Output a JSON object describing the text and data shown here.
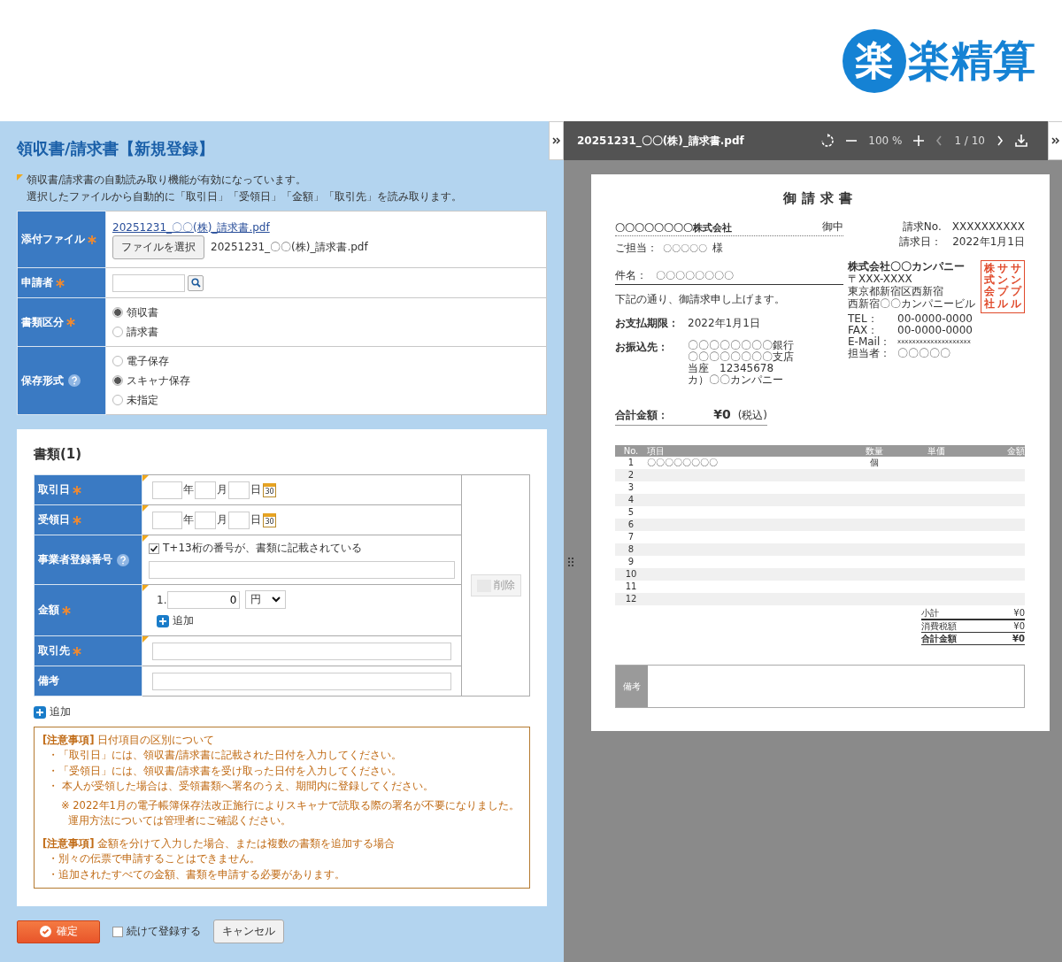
{
  "logo": {
    "mark": "楽",
    "text": "楽精算"
  },
  "form": {
    "title": "領収書/請求書【新規登録】",
    "notice": [
      "領収書/請求書の自動読み取り機能が有効になっています。",
      "選択したファイルから自動的に「取引日」「受領日」「金額」「取引先」を読み取ります。"
    ],
    "fields": [
      {
        "kind": "file",
        "label": "添付ファイル",
        "required": true,
        "help": false,
        "link": "20251231_〇〇(株)_請求書.pdf",
        "button": "ファイルを選択",
        "filename": "20251231_〇〇(株)_請求書.pdf"
      },
      {
        "kind": "search",
        "label": "申請者",
        "required": true,
        "help": false
      },
      {
        "kind": "radio",
        "label": "書類区分",
        "required": true,
        "help": false,
        "options": [
          {
            "label": "領収書",
            "selected": true
          },
          {
            "label": "請求書",
            "selected": false
          }
        ]
      },
      {
        "kind": "radio",
        "label": "保存形式",
        "required": false,
        "help": true,
        "options": [
          {
            "label": "電子保存",
            "selected": false
          },
          {
            "label": "スキャナ保存",
            "selected": true
          },
          {
            "label": "未指定",
            "selected": false
          }
        ]
      }
    ]
  },
  "documents": {
    "title": "書類(1)",
    "rows": [
      {
        "kind": "date",
        "label": "取引日",
        "required": true,
        "help": false,
        "auto_read": true,
        "units": [
          "年",
          "月",
          "日"
        ],
        "calendar": "30"
      },
      {
        "kind": "date",
        "label": "受領日",
        "required": true,
        "help": false,
        "auto_read": true,
        "units": [
          "年",
          "月",
          "日"
        ],
        "calendar": "30"
      },
      {
        "kind": "invoice",
        "label": "事業者登録番号",
        "required": false,
        "help": true,
        "auto_read": true,
        "checkbox": {
          "label": "T+13桁の番号が、書類に記載されている",
          "checked": true
        }
      },
      {
        "kind": "amount",
        "label": "金額",
        "required": true,
        "help": false,
        "auto_read": true,
        "index": "1.",
        "value": "0",
        "currency": "円",
        "add": "追加"
      },
      {
        "kind": "text",
        "label": "取引先",
        "required": true,
        "help": false,
        "auto_read": true
      },
      {
        "kind": "text",
        "label": "備考",
        "required": false,
        "help": false,
        "auto_read": false
      }
    ],
    "delete": {
      "label": "削除",
      "disabled": true
    },
    "add": "追加"
  },
  "notes": [
    {
      "heading": "**[注意事項]** 日付項目の区別について",
      "lines": [
        {
          "kind": "item",
          "text": "・「取引日」には、領収書/請求書に記載された日付を入力してください。"
        },
        {
          "kind": "item",
          "text": "・「受領日」には、領収書/請求書を受け取った日付を入力してください。"
        },
        {
          "kind": "item",
          "text": "・ 本人が受領した場合は、受領書類へ署名のうえ、期間内に登録してください。"
        },
        {
          "kind": "remark",
          "text": "※ 2022年1月の電子帳簿保存法改正施行によりスキャナで読取る際の署名が不要になりました。"
        },
        {
          "kind": "remark-cont",
          "text": "運用方法については管理者にご確認ください。"
        }
      ]
    },
    {
      "heading": "**[注意事項]** 金額を分けて入力した場合、または複数の書類を追加する場合",
      "lines": [
        {
          "kind": "plain",
          "text": "・別々の伝票で申請することはできません。"
        },
        {
          "kind": "plain",
          "text": "・追加されたすべての金額、書類を申請する必要があります。"
        }
      ]
    }
  ],
  "footer": {
    "confirm": "確定",
    "continue": {
      "label": "続けて登録する",
      "checked": false
    },
    "cancel": "キャンセル"
  },
  "viewer": {
    "filename": "20251231_〇〇(株)_請求書.pdf",
    "zoom": "100 %",
    "page": "1 / 10",
    "prev": {
      "disabled": true
    },
    "next": {
      "disabled": false
    },
    "document": {
      "title": "御請求書",
      "recipient": "〇〇〇〇〇〇〇〇株式会社",
      "honorific": "御中",
      "contact_label": "ご担当：",
      "contact": "〇〇〇〇〇",
      "contact_suffix": "様",
      "subject_label": "件名：",
      "subject": "〇〇〇〇〇〇〇〇",
      "meta": [
        {
          "label": "請求No.",
          "value": "XXXXXXXXXX"
        },
        {
          "label": "請求日：",
          "value": "2022年1月1日"
        }
      ],
      "intro": "下記の通り、御請求申し上げます。",
      "due": {
        "label": "お支払期限：",
        "value": "2022年1月1日"
      },
      "bank": {
        "label": "お振込先：",
        "lines": [
          "〇〇〇〇〇〇〇〇銀行",
          "〇〇〇〇〇〇〇〇支店",
          "当座　12345678",
          "カ）〇〇カンパニー"
        ]
      },
      "issuer": {
        "name": "株式会社〇〇カンパニー",
        "address": [
          "〒XXX-XXXX",
          "東京都新宿区西新宿",
          "西新宿〇〇カンパニービル"
        ],
        "contacts": [
          {
            "label": "TEL：",
            "value": "00-0000-0000"
          },
          {
            "label": "FAX：",
            "value": "00-0000-0000"
          },
          {
            "label": "E-Mail：",
            "value": "xxxxxxxxxxxxxxxxxxxx"
          },
          {
            "label": "担当者：",
            "value": "〇〇〇〇〇"
          }
        ],
        "stamp": [
          "株式会社",
          "サンプル",
          "サンプル"
        ]
      },
      "total": {
        "label": "合計金額：",
        "value": "¥0",
        "note": "(税込)"
      },
      "table": {
        "columns": [
          "No.",
          "項目",
          "数量",
          "単価",
          "金額"
        ],
        "rows": [
          {
            "no": "1",
            "item": "〇〇〇〇〇〇〇〇",
            "qty": "個"
          },
          {
            "no": "2"
          },
          {
            "no": "3"
          },
          {
            "no": "4"
          },
          {
            "no": "5"
          },
          {
            "no": "6"
          },
          {
            "no": "7"
          },
          {
            "no": "8"
          },
          {
            "no": "9"
          },
          {
            "no": "10"
          },
          {
            "no": "11"
          },
          {
            "no": "12"
          }
        ]
      },
      "summary": [
        {
          "kind": "line",
          "label": "小計",
          "value": "¥0"
        },
        {
          "kind": "line",
          "label": "消費税額",
          "value": "¥0"
        },
        {
          "kind": "total",
          "label": "合計金額",
          "value": "¥0"
        }
      ],
      "remarks_label": "備考"
    }
  }
}
